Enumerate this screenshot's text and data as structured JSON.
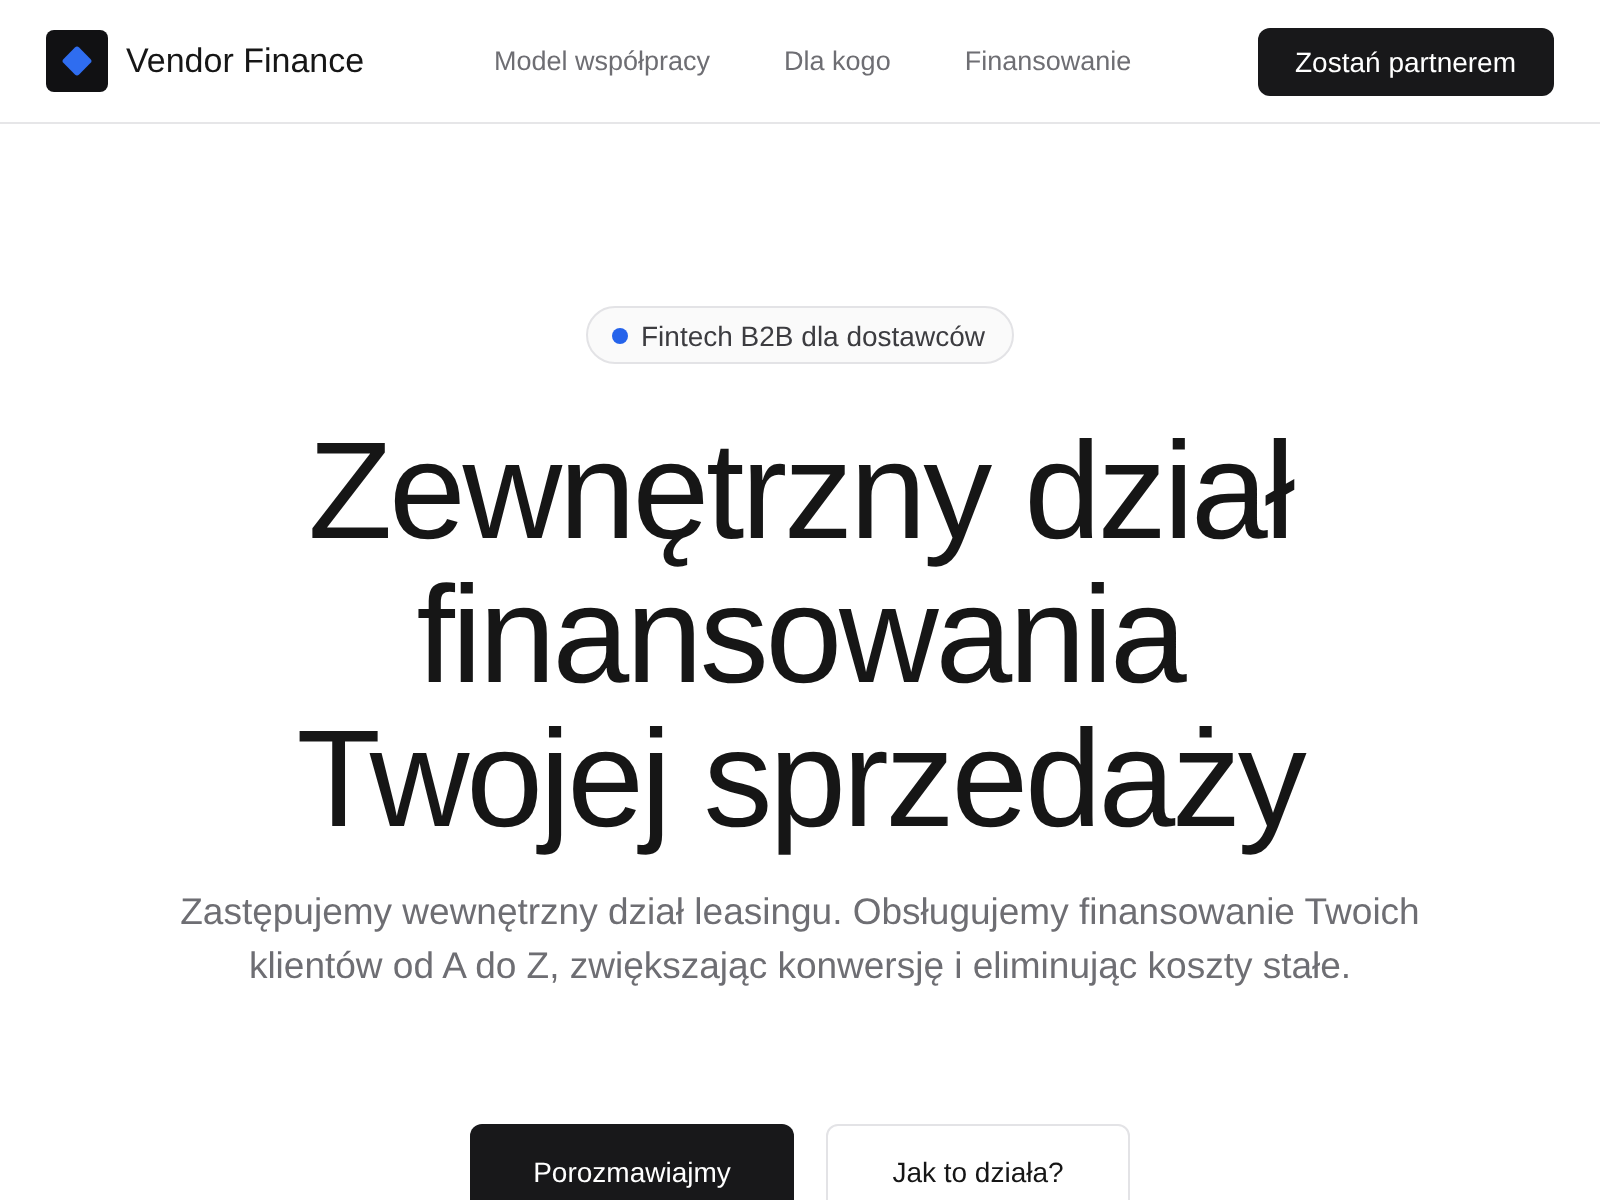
{
  "header": {
    "logo_text": "Vendor Finance",
    "nav": [
      "Model współpracy",
      "Dla kogo",
      "Finansowanie"
    ],
    "cta": "Zostań partnerem"
  },
  "hero": {
    "badge": "Fintech B2B dla dostawców",
    "headline": "Zewnętrzny dział\nfinansowania\nTwojej sprzedaży",
    "subtitle": "Zastępujemy wewnętrzny dział leasingu. Obsługujemy finansowanie Twoich klientów od A do Z, zwiększając konwersję i eliminując koszty stałe.",
    "buttons": [
      {
        "label": "Porozmawiajmy",
        "kind": "primary"
      },
      {
        "label": "Jak to działa?",
        "kind": "secondary"
      }
    ]
  }
}
